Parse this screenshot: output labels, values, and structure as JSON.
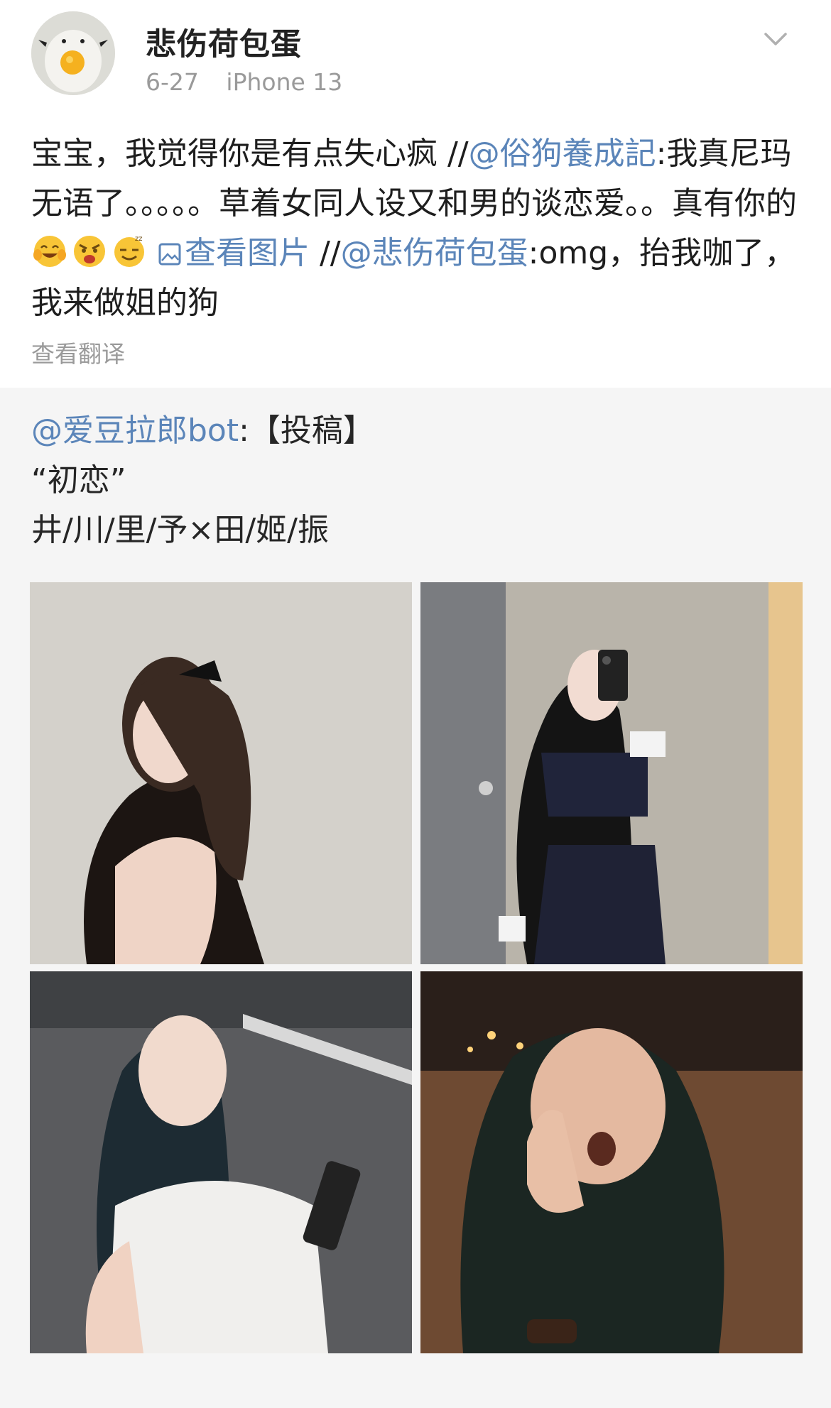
{
  "post": {
    "username": "悲伤荷包蛋",
    "date": "6-27",
    "device": "iPhone 13",
    "text": {
      "part1": "宝宝，我觉得你是有点失心疯 //",
      "mention1": "@俗狗養成記",
      "part2": ":我真尼玛无语了。。。。。草着女同人设又和男的谈恋爱。。真有你的",
      "emojis": [
        "laughing-tears-emoji",
        "angry-emoji",
        "sweat-smile-emoji"
      ],
      "view_pic_label": "查看图片",
      "part3": " //",
      "mention2": "@悲伤荷包蛋",
      "part4": ":omg，抬我咖了，我来做姐的狗"
    },
    "translate_label": "查看翻译"
  },
  "repost": {
    "mention": "@爱豆拉郎bot",
    "after_mention": ":【投稿】",
    "line2": "“初恋”",
    "line3": "井/川/里/予×田/姬/振",
    "photos": [
      {
        "name": "photo-1",
        "description_icon": "photo"
      },
      {
        "name": "photo-2",
        "description_icon": "photo"
      },
      {
        "name": "photo-3",
        "description_icon": "photo"
      },
      {
        "name": "photo-4",
        "description_icon": "photo"
      }
    ]
  },
  "colors": {
    "link": "#5b85b9",
    "meta": "#9a9a9a",
    "repost_bg": "#f5f5f5"
  }
}
